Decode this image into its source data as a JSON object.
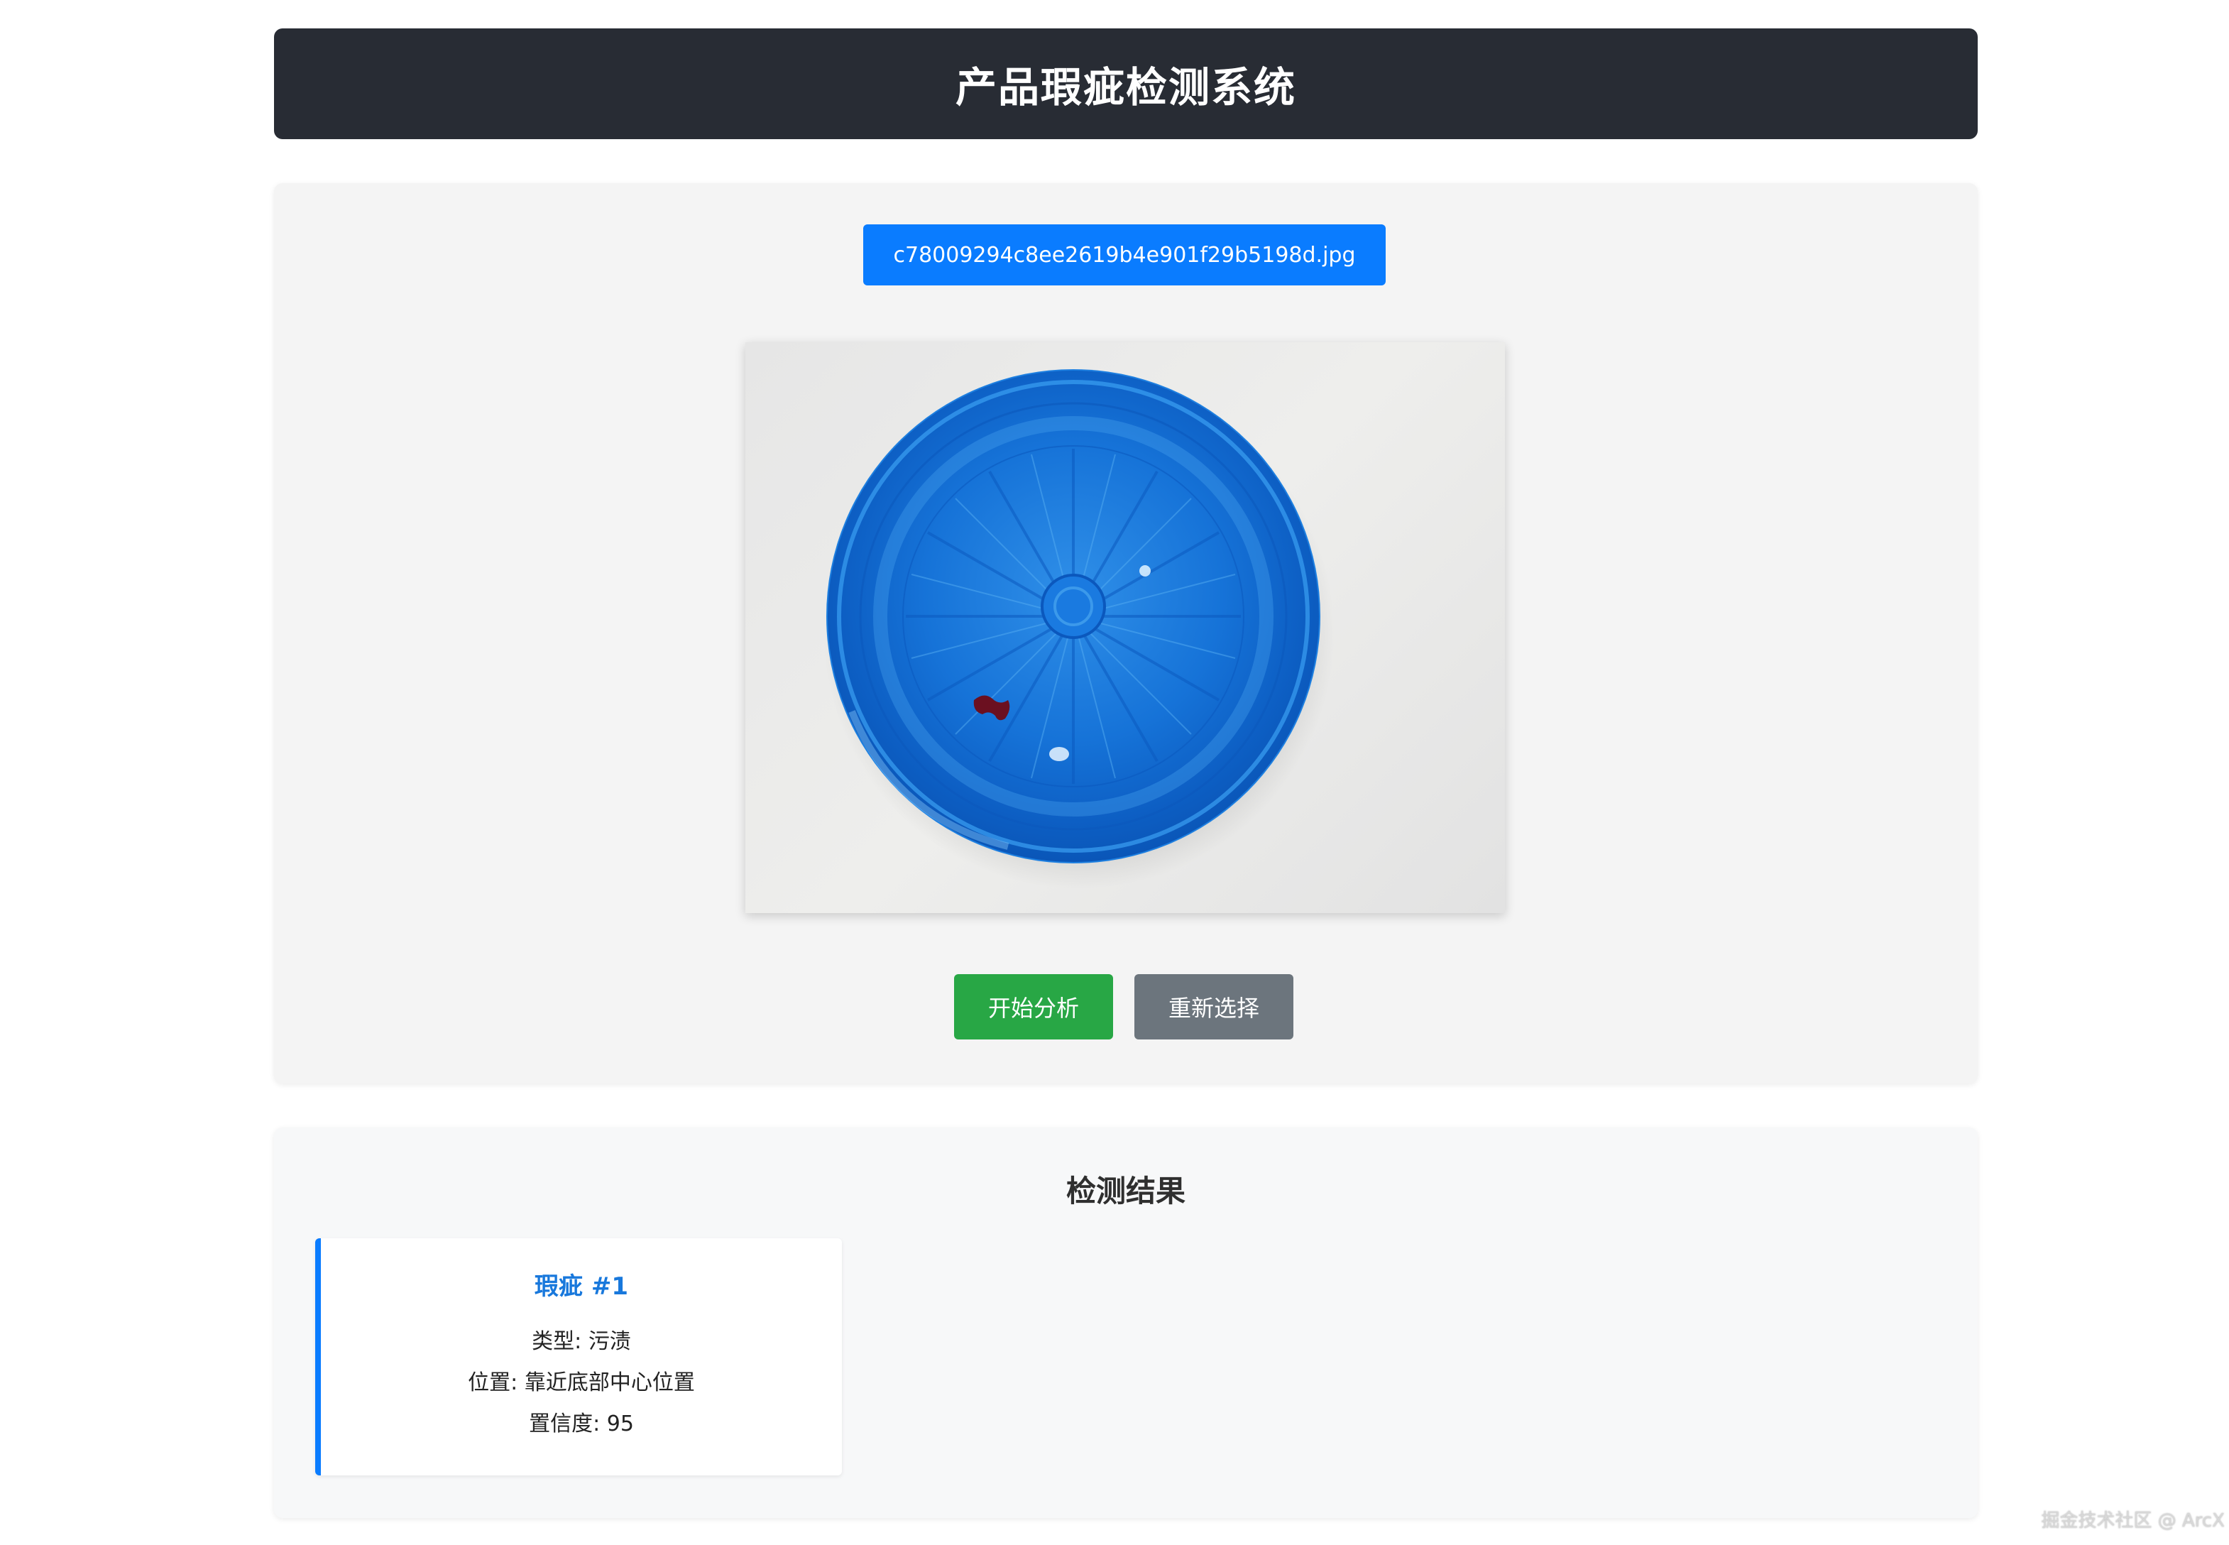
{
  "header": {
    "title": "产品瑕疵检测系统"
  },
  "upload": {
    "file_name": "c78009294c8ee2619b4e901f29b5198d.jpg",
    "start_label": "开始分析",
    "reselect_label": "重新选择"
  },
  "results": {
    "title": "检测结果",
    "defects": [
      {
        "title": "瑕疵 #1",
        "type_label": "类型:",
        "type_value": "污渍",
        "position_label": "位置:",
        "position_value": "靠近底部中心位置",
        "confidence_label": "置信度:",
        "confidence_value": "95"
      }
    ]
  },
  "watermark": "掘金技术社区 @ ArcX",
  "colors": {
    "header_bg": "#282c34",
    "file_button": "#0a7cff",
    "start_button": "#28a745",
    "reselect_button": "#6c757d",
    "card_accent": "#0a7cff",
    "card_title": "#1878dc"
  }
}
